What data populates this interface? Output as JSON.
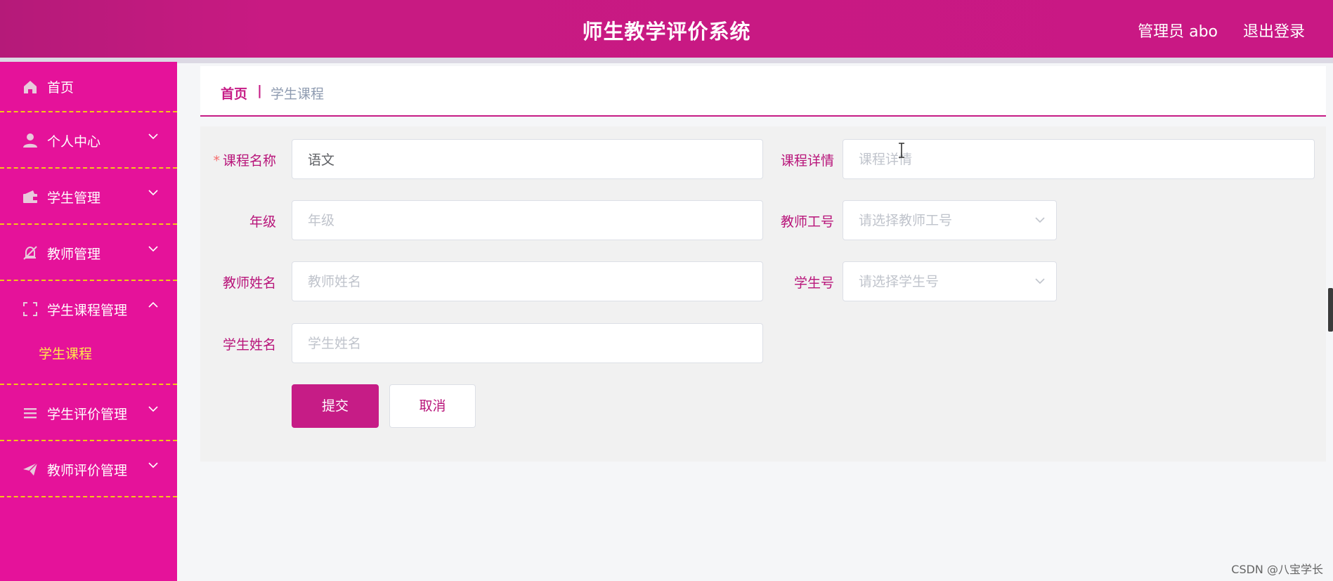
{
  "header": {
    "title": "师生教学评价系统",
    "user": "管理员 abo",
    "logout": "退出登录"
  },
  "sidebar": {
    "items": [
      {
        "label": "首页",
        "icon": "home-icon"
      },
      {
        "label": "个人中心",
        "icon": "user-icon"
      },
      {
        "label": "学生管理",
        "icon": "wallet-icon"
      },
      {
        "label": "教师管理",
        "icon": "bell-off-icon"
      },
      {
        "label": "学生课程管理",
        "icon": "fullscreen-icon",
        "expanded": true,
        "children": [
          {
            "label": "学生课程"
          }
        ]
      },
      {
        "label": "学生评价管理",
        "icon": "list-icon"
      },
      {
        "label": "教师评价管理",
        "icon": "send-icon"
      }
    ]
  },
  "breadcrumb": {
    "home": "首页",
    "separator": "|",
    "current": "学生课程"
  },
  "form": {
    "course_name": {
      "label": "课程名称",
      "required_mark": "*",
      "value": "语文"
    },
    "course_detail": {
      "label": "课程详情",
      "placeholder": "课程详情"
    },
    "grade": {
      "label": "年级",
      "placeholder": "年级"
    },
    "teacher_id": {
      "label": "教师工号",
      "placeholder": "请选择教师工号"
    },
    "teacher_name": {
      "label": "教师姓名",
      "placeholder": "教师姓名"
    },
    "student_id": {
      "label": "学生号",
      "placeholder": "请选择学生号"
    },
    "student_name": {
      "label": "学生姓名",
      "placeholder": "学生姓名"
    },
    "submit": "提交",
    "cancel": "取消"
  },
  "watermark": "CSDN @八宝学长",
  "colors": {
    "header": "#c81a82",
    "sidebar": "#e5129a",
    "accent": "#c61c86",
    "submenu_active": "#ffe94a",
    "divider": "#f5c518"
  }
}
